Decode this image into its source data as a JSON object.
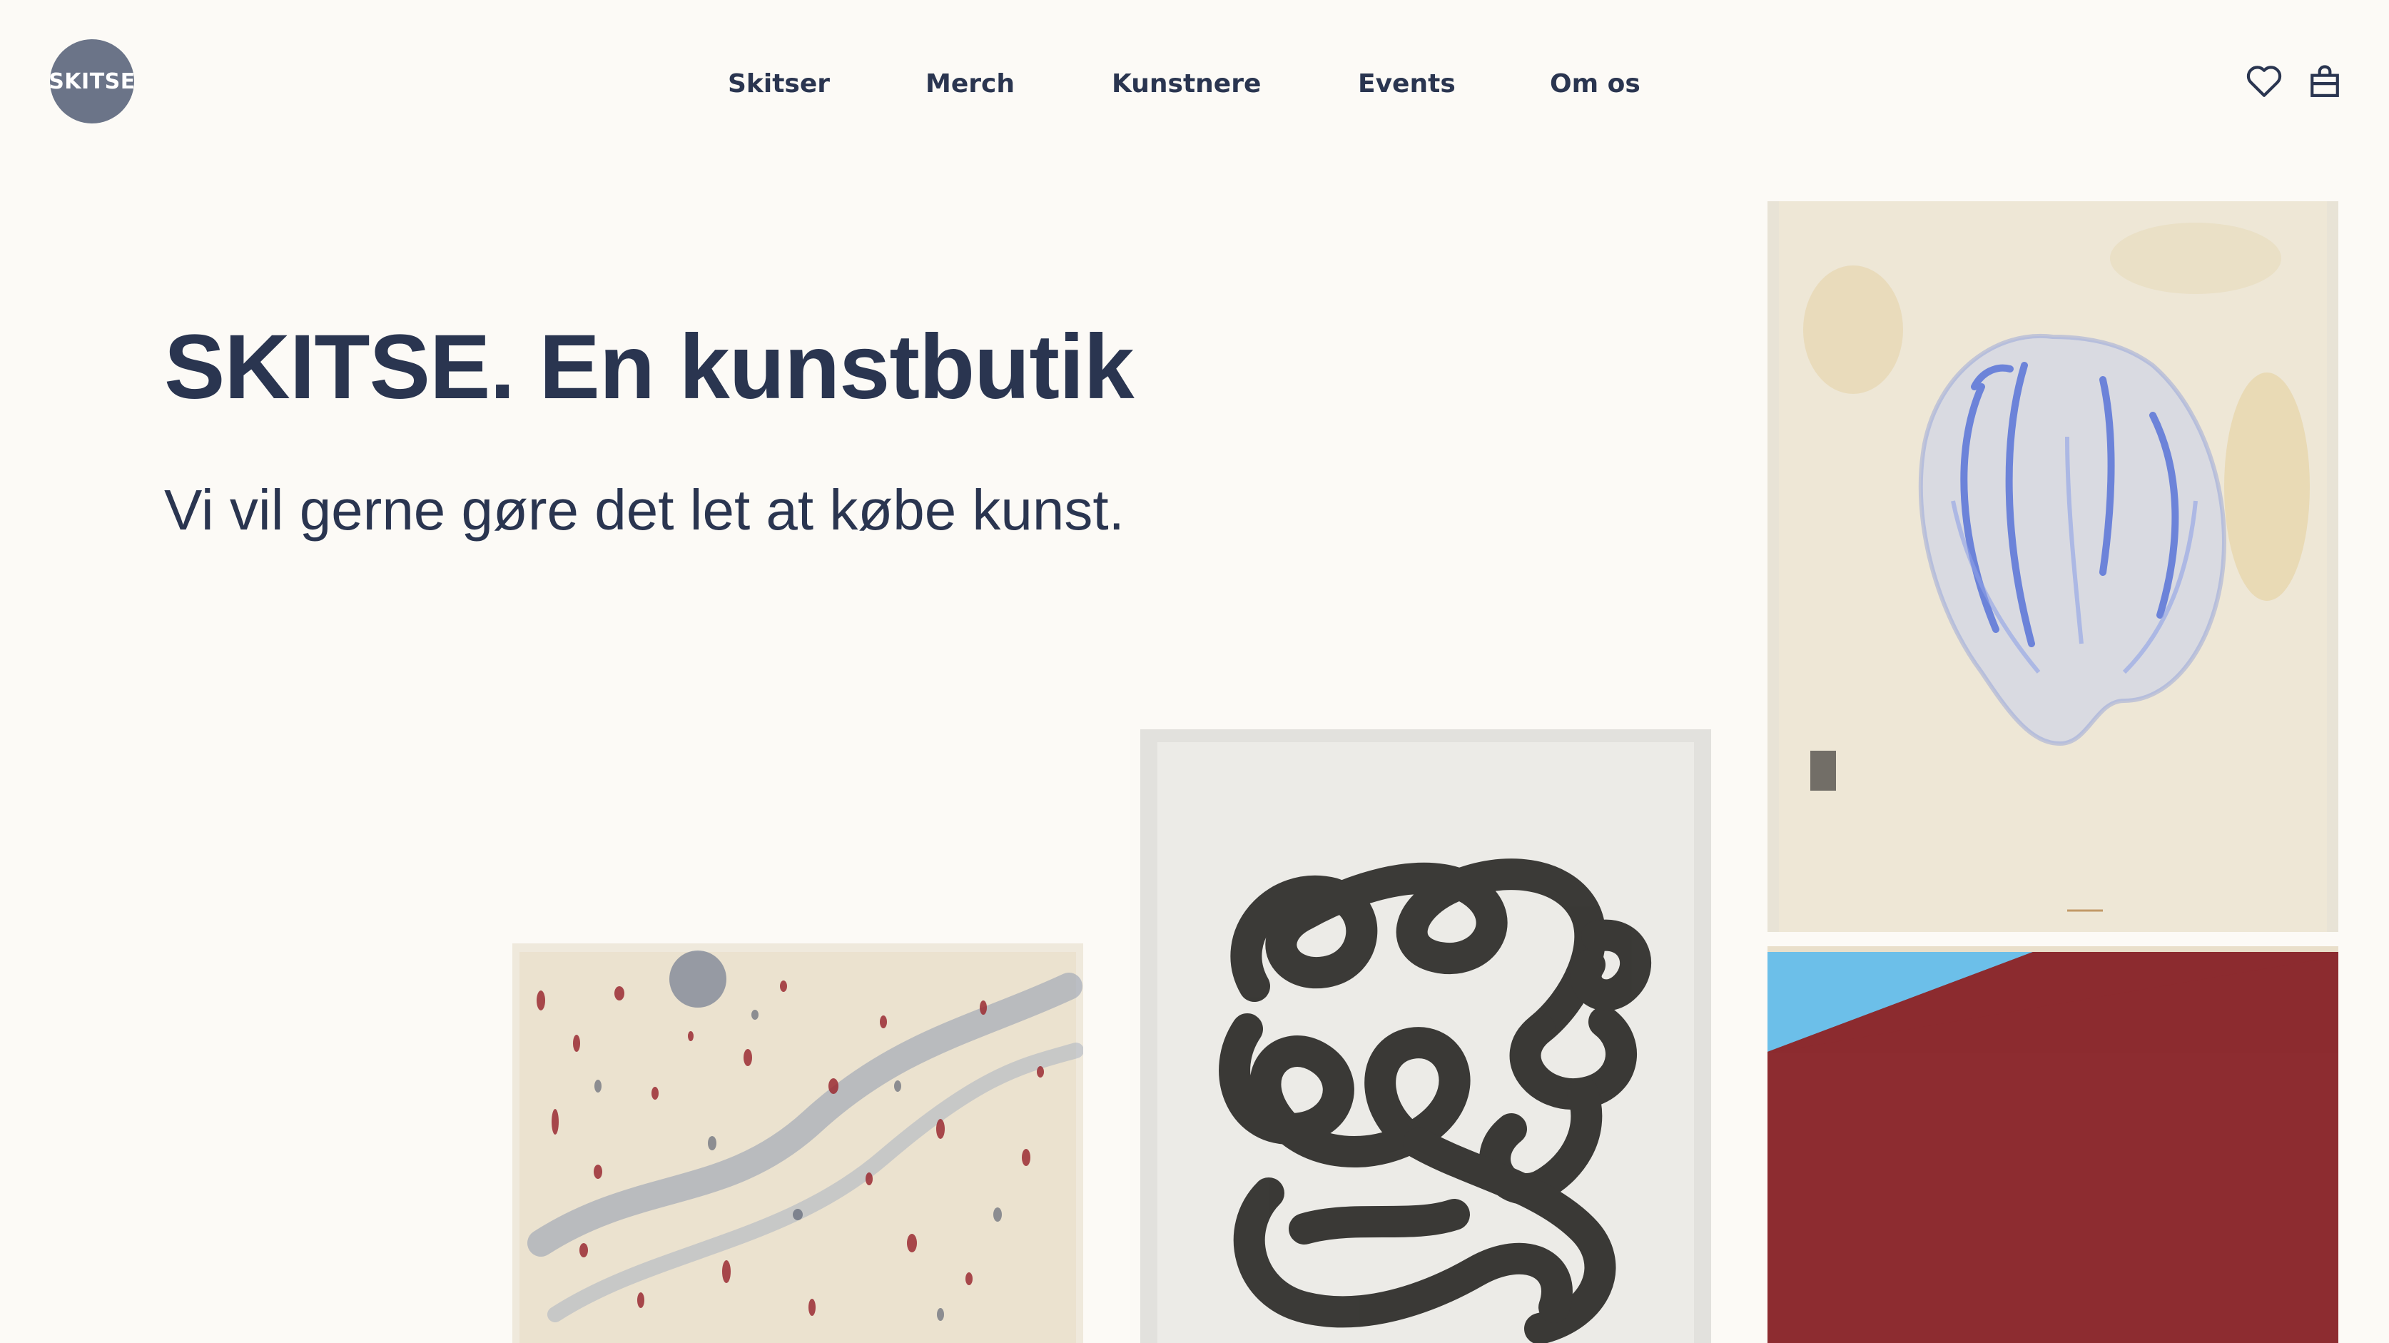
{
  "brand": {
    "logo_text": "SKITSE",
    "logo_color": "#6b7488"
  },
  "nav": {
    "items": [
      {
        "label": "Skitser"
      },
      {
        "label": "Merch"
      },
      {
        "label": "Kunstnere"
      },
      {
        "label": "Events"
      },
      {
        "label": "Om os"
      }
    ]
  },
  "header_icons": {
    "favorites": "heart-icon",
    "cart": "shopping-bag-icon"
  },
  "hero": {
    "title": "SKITSE. En kunstbutik",
    "subtitle": "Vi vil gerne gøre det let at købe kunst."
  },
  "artworks": [
    {
      "name": "splatter-artwork",
      "palette": [
        "#efe9dc",
        "#9b2b33",
        "#7d8aa3"
      ]
    },
    {
      "name": "black-loops-artwork",
      "palette": [
        "#e7e6e2",
        "#2b2a28"
      ]
    },
    {
      "name": "blue-shell-artwork",
      "palette": [
        "#ede7d8",
        "#3e5fd6"
      ]
    },
    {
      "name": "red-blue-artwork",
      "palette": [
        "#8c2b2f",
        "#6cbfe9"
      ]
    }
  ],
  "colors": {
    "background": "#fcfaf6",
    "text": "#2a3550"
  }
}
